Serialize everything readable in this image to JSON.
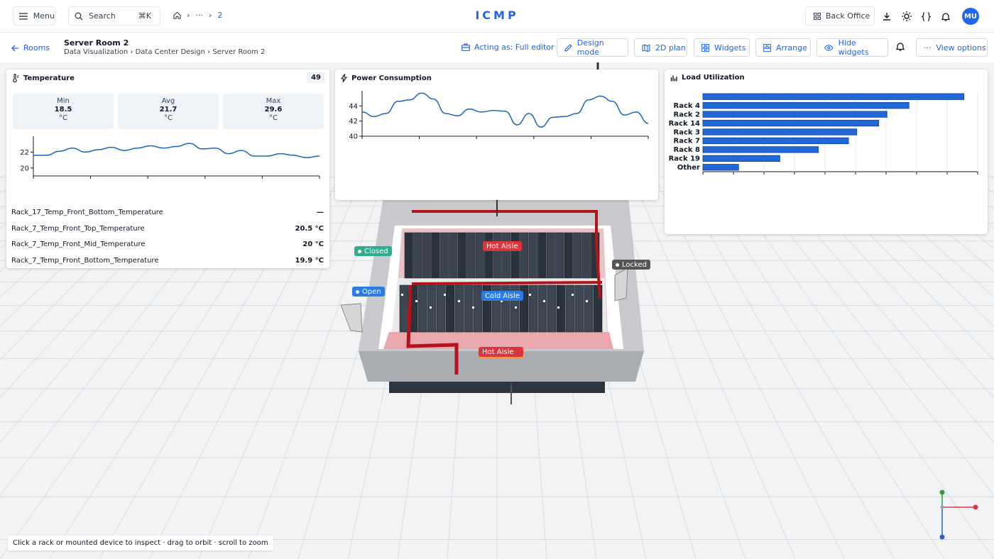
{
  "topbar": {
    "menu_label": "Menu",
    "search_label": "Search",
    "search_shortcut": "⌘K",
    "breadcrumb_more": "···",
    "breadcrumb_current": "2",
    "brand": "ICMP",
    "back_office_label": "Back Office",
    "avatar_initials": "MU"
  },
  "subheader": {
    "rooms_link": "Rooms",
    "room_title": "Server Room 2",
    "room_path": "Data Visualization › Data Center Design › Server Room 2",
    "acting_as": "Acting as: Full editor",
    "buttons": {
      "design_mode": "Design mode",
      "plan_2d": "2D plan",
      "widgets": "Widgets",
      "arrange": "Arrange",
      "hide_widgets": "Hide widgets",
      "view_options": "View options"
    }
  },
  "temperature": {
    "title": "Temperature",
    "count": "49",
    "stats": [
      {
        "label": "Min",
        "value": "18.5",
        "unit": "°C"
      },
      {
        "label": "Avg",
        "value": "21.7",
        "unit": "°C"
      },
      {
        "label": "Max",
        "value": "29.6",
        "unit": "°C"
      }
    ],
    "sensors": [
      {
        "name": "Rack_17_Temp_Front_Bottom_Temperature",
        "value": "—"
      },
      {
        "name": "Rack_7_Temp_Front_Top_Temperature",
        "value": "20.5 °C"
      },
      {
        "name": "Rack_7_Temp_Front_Mid_Temperature",
        "value": "20 °C"
      },
      {
        "name": "Rack_7_Temp_Front_Bottom_Temperature",
        "value": "19.9 °C"
      }
    ]
  },
  "power": {
    "title": "Power Consumption"
  },
  "load": {
    "title": "Load Utilization"
  },
  "chart_data": [
    {
      "type": "line",
      "title": "",
      "ylim": [
        19,
        24
      ],
      "yticks": [
        20,
        22
      ],
      "series": [
        {
          "values": [
            21.6,
            21.6,
            22.1,
            22.5,
            22.0,
            22.3,
            22.6,
            22.2,
            22.5,
            22.8,
            22.5,
            22.7,
            23.1,
            22.4,
            22.5,
            21.8,
            22.2,
            21.5,
            21.5,
            21.8,
            21.6,
            21.3,
            21.5
          ]
        }
      ],
      "xlabel": "",
      "ylabel": ""
    },
    {
      "type": "line",
      "title": "",
      "ylim": [
        40,
        46
      ],
      "yticks": [
        40,
        42,
        44
      ],
      "series": [
        {
          "values": [
            43.2,
            42.6,
            43.0,
            44.6,
            44.8,
            45.7,
            44.9,
            43.0,
            42.7,
            43.6,
            43.2,
            43.4,
            43.3,
            41.5,
            43.0,
            41.2,
            42.5,
            42.6,
            43.0,
            44.8,
            45.3,
            44.6,
            42.8,
            43.2,
            41.7
          ]
        }
      ],
      "xlabel": "",
      "ylabel": ""
    },
    {
      "type": "bar",
      "orientation": "horizontal",
      "title": "",
      "categories": [
        "Rack 4",
        "Rack 2",
        "Rack 14",
        "Rack 3",
        "Rack 7",
        "Rack 8",
        "Rack 19",
        "Other"
      ],
      "values": [
        95,
        75,
        67,
        64,
        56,
        53,
        42,
        28,
        13
      ],
      "xlim": [
        0,
        100
      ],
      "xlabel": "",
      "ylabel": ""
    }
  ],
  "scene": {
    "tags": {
      "closed": "Closed",
      "open": "Open",
      "locked": "Locked",
      "hot_aisle_top": "Hot Aisle",
      "cold_aisle": "Cold Aisle",
      "hot_aisle_bottom": "Hot Aisle"
    },
    "colors": {
      "closed": "#2fae8f",
      "open": "#2d7be5",
      "locked": "#555555",
      "hot": "#d9363e",
      "cold": "#2d7be5",
      "hot_glow": "#f39c3a"
    }
  },
  "hint": "Click a rack or mounted device to inspect · drag to orbit · scroll to zoom"
}
